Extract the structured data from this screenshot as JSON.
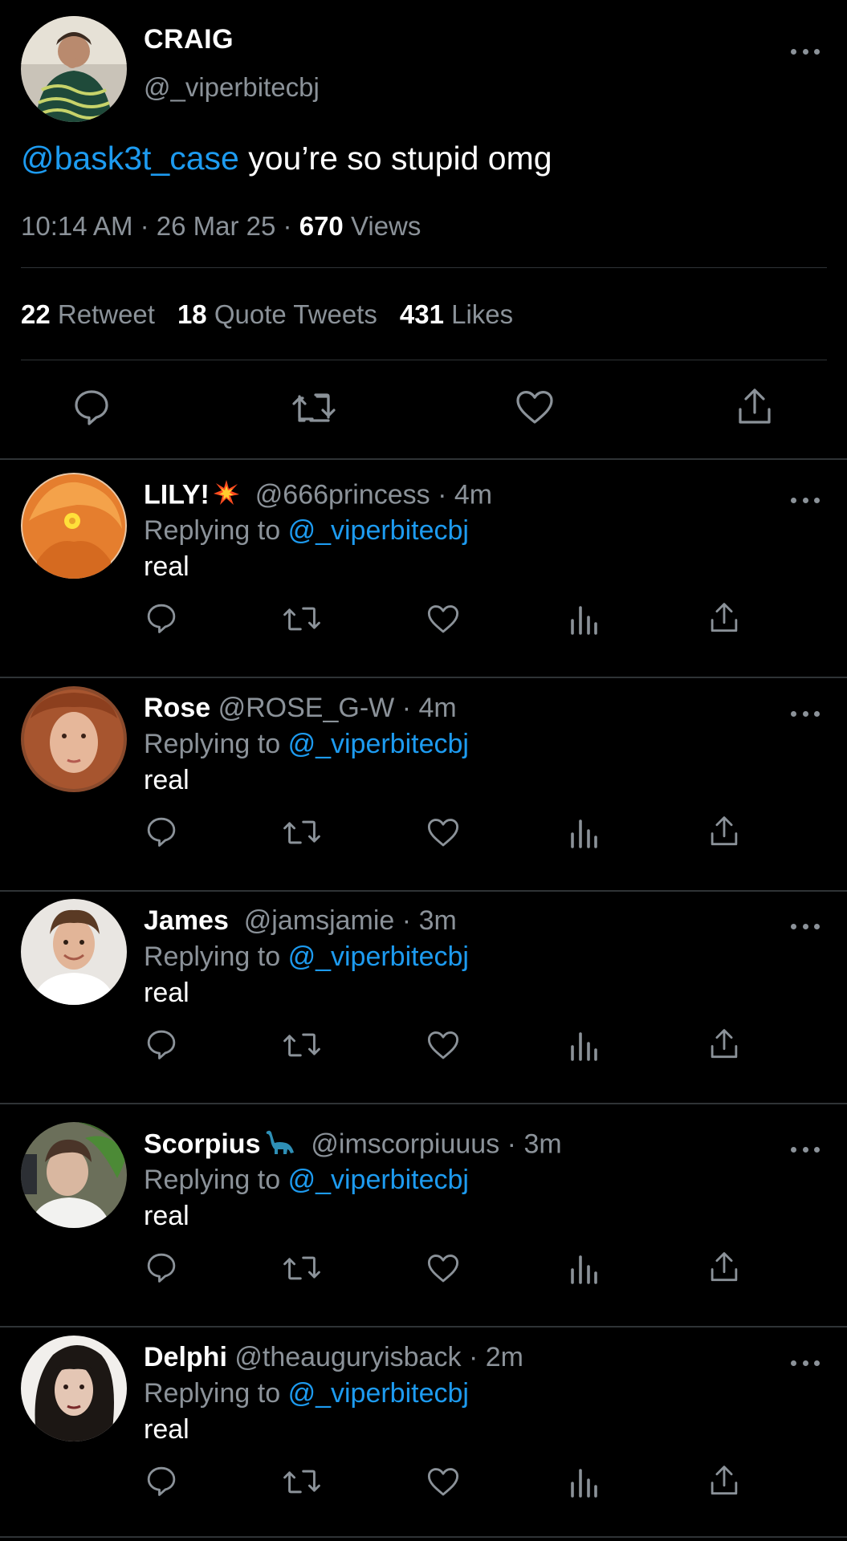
{
  "tweet": {
    "author_name": "CRAIG",
    "author_handle": "@_viperbitecbj",
    "mention": "@bask3t_case",
    "text": " you’re so stupid omg",
    "time": "10:14 AM",
    "date": "26 Mar 25",
    "views_count": "670",
    "views_label": "Views",
    "retweets_count": "22",
    "retweets_label": "Retweet",
    "quotes_count": "18",
    "quotes_label": "Quote Tweets",
    "likes_count": "431",
    "likes_label": "Likes"
  },
  "replies": [
    {
      "name": "LILY!",
      "badge": "collision-emoji",
      "handle": "@666princess",
      "time": "4m",
      "replying_label": "Replying to",
      "replying_to": "@_viperbitecbj",
      "text": "real"
    },
    {
      "name": "Rose",
      "handle": "@ROSE_G-W",
      "time": "4m",
      "replying_label": "Replying to",
      "replying_to": "@_viperbitecbj",
      "text": "real"
    },
    {
      "name": "James",
      "handle": "@jamsjamie",
      "time": "3m",
      "replying_label": "Replying to",
      "replying_to": "@_viperbitecbj",
      "text": "real"
    },
    {
      "name": "Scorpius",
      "badge": "sauropod-emoji",
      "handle": "@imscorpiuuus",
      "time": "3m",
      "replying_label": "Replying to",
      "replying_to": "@_viperbitecbj",
      "text": "real"
    },
    {
      "name": "Delphi",
      "handle": "@theauguryisback",
      "time": "2m",
      "replying_label": "Replying to",
      "replying_to": "@_viperbitecbj",
      "text": "real"
    }
  ],
  "separator": "·",
  "colors": {
    "background": "#000000",
    "text": "#ffffff",
    "muted": "#8b9299",
    "link": "#1d9bf0",
    "divider": "#2f3336"
  },
  "icons": [
    "reply-icon",
    "retweet-icon",
    "like-icon",
    "views-icon",
    "share-icon",
    "more-icon"
  ]
}
